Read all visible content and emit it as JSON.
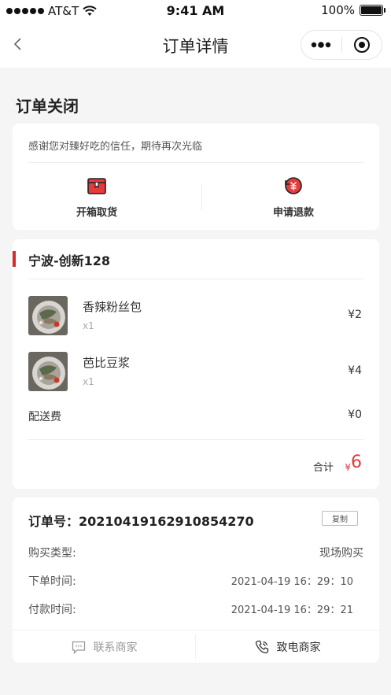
{
  "status_bar": {
    "carrier": "AT&T",
    "time": "9:41 AM",
    "battery": "100%"
  },
  "nav": {
    "title": "订单详情"
  },
  "order_status": "订单关闭",
  "thanks_message": "感谢您对臻好吃的信任，期待再次光临",
  "actions": [
    {
      "label": "开箱取货",
      "icon": "box-icon"
    },
    {
      "label": "申请退款",
      "icon": "refund-icon"
    }
  ],
  "store": {
    "name": "宁波-创新128"
  },
  "items": [
    {
      "name": "香辣粉丝包",
      "qty": "x1",
      "price": "¥2"
    },
    {
      "name": "芭比豆浆",
      "qty": "x1",
      "price": "¥4"
    }
  ],
  "delivery_fee": {
    "label": "配送费",
    "value": "¥0"
  },
  "total": {
    "label": "合计",
    "currency": "¥",
    "value": "6"
  },
  "order_info": {
    "order_no": "订单号：20210419162910854270",
    "copy_label": "复制",
    "rows": [
      {
        "label": "购买类型:",
        "value": "现场购买"
      },
      {
        "label": "下单时间:",
        "value": "2021-04-19 16：29：10"
      },
      {
        "label": "付款时间:",
        "value": "2021-04-19 16：29：21"
      }
    ]
  },
  "contact": {
    "message_label": "联系商家",
    "call_label": "致电商家"
  },
  "colors": {
    "accent_red": "#d92a2a",
    "price_red": "#e23a3a"
  }
}
